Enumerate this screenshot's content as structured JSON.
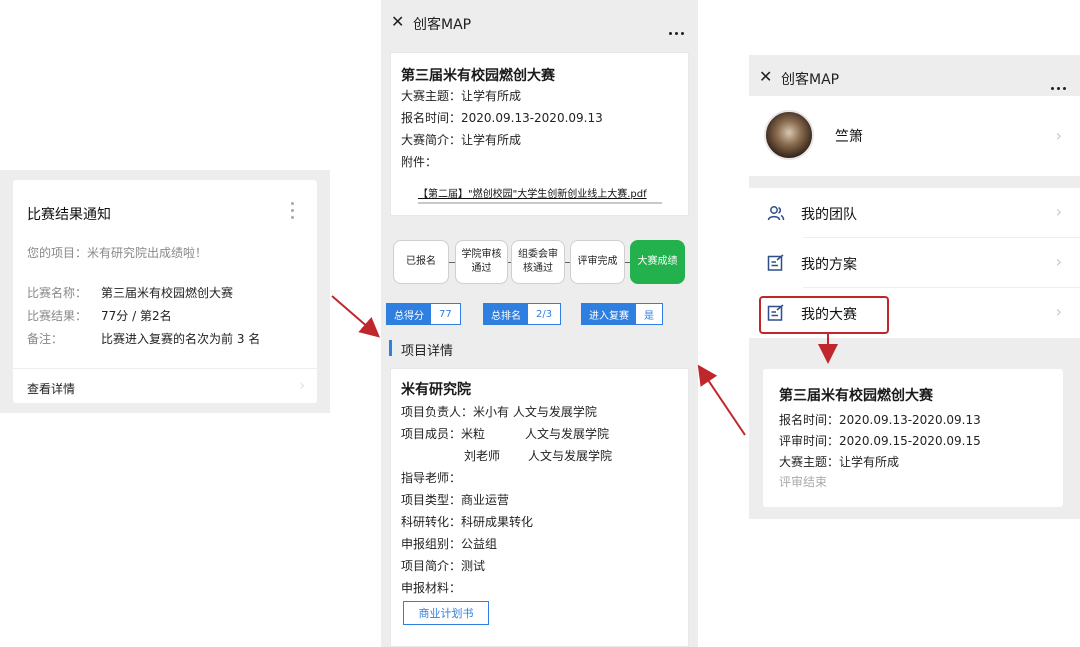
{
  "notice": {
    "title": "比赛结果通知",
    "project_line": "您的项目：米有研究院出成绩啦！",
    "rows": [
      {
        "key": "比赛名称：",
        "value": "第三届米有校园燃创大赛"
      },
      {
        "key": "比赛结果：",
        "value": "77分 / 第2名"
      },
      {
        "key": "备注：",
        "value": "比赛进入复赛的名次为前 3 名"
      }
    ],
    "detail_label": "查看详情",
    "chevron": "›"
  },
  "nav": {
    "close": "✕",
    "title": "创客MAP"
  },
  "contest": {
    "name": "第三届米有校园燃创大赛",
    "theme": "大赛主题：让学有所成",
    "signup": "报名时间：2020.09.13-2020.09.13",
    "intro": "大赛简介：让学有所成",
    "attachment_label": "附件：",
    "attachment_file": "【第二届】\"燃创校园\"大学生创新创业线上大赛.pdf"
  },
  "steps": [
    {
      "label1": "已报名",
      "label2": ""
    },
    {
      "label1": "学院审核",
      "label2": "通过"
    },
    {
      "label1": "组委会审",
      "label2": "核通过"
    },
    {
      "label1": "评审完成",
      "label2": ""
    },
    {
      "label1": "大赛成绩",
      "label2": ""
    }
  ],
  "stats": [
    {
      "key": "总得分",
      "value": "77"
    },
    {
      "key": "总排名",
      "value": "2/3"
    },
    {
      "key": "进入复赛",
      "value": "是"
    }
  ],
  "project": {
    "section_title": "项目详情",
    "name": "米有研究院",
    "leader": "项目负责人：米小有    人文与发展学院",
    "members_label": "项目成员：",
    "member1_name": "米粒",
    "member1_school": "人文与发展学院",
    "member2_name": "刘老师",
    "member2_school": "人文与发展学院",
    "advisor": "指导老师：",
    "type": "项目类型：商业运营",
    "research": "科研转化：科研成果转化",
    "group": "申报组别：公益组",
    "intro": "项目简介：测试",
    "materials": "申报材料：",
    "plan_button": "商业计划书"
  },
  "right": {
    "profile_name": "竺箫",
    "menu": [
      {
        "label": "我的团队"
      },
      {
        "label": "我的方案"
      },
      {
        "label": "我的大赛"
      }
    ],
    "result": {
      "title": "第三届米有校园燃创大赛",
      "signup": "报名时间：2020.09.13-2020.09.13",
      "review": "评审时间：2020.09.15-2020.09.15",
      "theme": "大赛主题：让学有所成",
      "status": "评审结束"
    }
  },
  "colors": {
    "accent_blue": "#2f7fe0",
    "active_green": "#22b14c",
    "highlight_red": "#c0272d"
  }
}
